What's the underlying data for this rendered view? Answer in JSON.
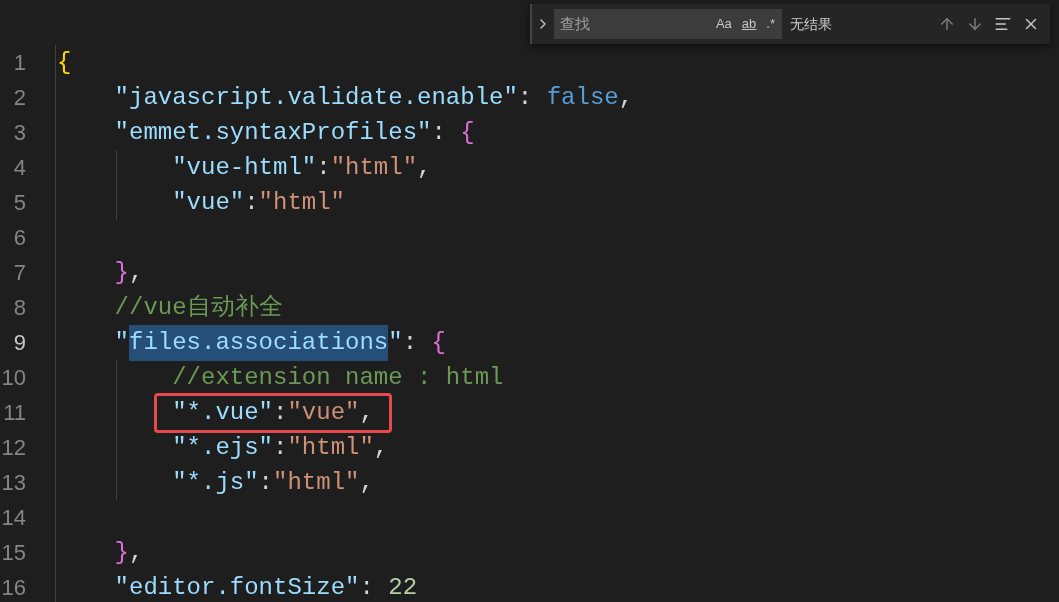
{
  "find_widget": {
    "expanded": false,
    "placeholder": "查找",
    "options": [
      {
        "label": "Aa",
        "selected": false
      },
      {
        "label": "ab",
        "selected": false
      },
      {
        "label": ".*",
        "selected": false
      }
    ],
    "result": "无结果"
  },
  "editor": {
    "lines": [
      {
        "number": "1",
        "current": false,
        "highlighted": false,
        "tokens": [
          {
            "kind": "brace-gold",
            "text": "{"
          }
        ]
      },
      {
        "number": "2",
        "current": false,
        "highlighted": false,
        "tokens": [
          {
            "kind": "key",
            "text": "\"javascript.validate.enable\""
          },
          {
            "kind": "plain",
            "text": ": "
          },
          {
            "kind": "keyword",
            "text": "false"
          },
          {
            "kind": "plain",
            "text": ","
          }
        ]
      },
      {
        "number": "3",
        "current": false,
        "highlighted": false,
        "tokens": [
          {
            "kind": "key",
            "text": "\"emmet.syntaxProfiles\""
          },
          {
            "kind": "plain",
            "text": ": "
          },
          {
            "kind": "brace-pink",
            "text": "{"
          }
        ]
      },
      {
        "number": "4",
        "current": false,
        "highlighted": false,
        "tokens": [
          {
            "kind": "key",
            "text": "\"vue-html\""
          },
          {
            "kind": "plain",
            "text": ":"
          },
          {
            "kind": "string",
            "text": "\"html\""
          },
          {
            "kind": "plain",
            "text": ","
          }
        ]
      },
      {
        "number": "5",
        "current": false,
        "highlighted": false,
        "tokens": [
          {
            "kind": "key",
            "text": "\"vue\""
          },
          {
            "kind": "plain",
            "text": ":"
          },
          {
            "kind": "string",
            "text": "\"html\""
          }
        ]
      },
      {
        "number": "6",
        "current": false,
        "highlighted": false
      },
      {
        "number": "7",
        "current": false,
        "highlighted": false,
        "tokens": [
          {
            "kind": "brace-pink",
            "text": "}"
          },
          {
            "kind": "plain",
            "text": ","
          }
        ]
      },
      {
        "number": "8",
        "current": false,
        "highlighted": false,
        "tokens": [
          {
            "kind": "comment",
            "text": "//vue自动补全"
          }
        ]
      },
      {
        "number": "9",
        "current": true,
        "highlighted": false,
        "tokens": [
          {
            "kind": "key",
            "text": "\""
          },
          {
            "kind": "key",
            "text": "files.associations",
            "selected": true
          },
          {
            "kind": "key",
            "text": "\""
          },
          {
            "kind": "plain",
            "text": ": "
          },
          {
            "kind": "brace-pink",
            "text": "{"
          }
        ]
      },
      {
        "number": "10",
        "current": false,
        "highlighted": false,
        "tokens": [
          {
            "kind": "comment",
            "text": "//extension name : html"
          }
        ]
      },
      {
        "number": "11",
        "current": false,
        "highlighted": true,
        "tokens": [
          {
            "kind": "key",
            "text": "\"*.vue\""
          },
          {
            "kind": "plain",
            "text": ":"
          },
          {
            "kind": "string",
            "text": "\"vue\""
          },
          {
            "kind": "plain",
            "text": ","
          }
        ]
      },
      {
        "number": "12",
        "current": false,
        "highlighted": false,
        "tokens": [
          {
            "kind": "key",
            "text": "\"*.ejs\""
          },
          {
            "kind": "plain",
            "text": ":"
          },
          {
            "kind": "string",
            "text": "\"html\""
          },
          {
            "kind": "plain",
            "text": ","
          }
        ]
      },
      {
        "number": "13",
        "current": false,
        "highlighted": false,
        "tokens": [
          {
            "kind": "key",
            "text": "\"*.js\""
          },
          {
            "kind": "plain",
            "text": ":"
          },
          {
            "kind": "string",
            "text": "\"html\""
          },
          {
            "kind": "plain",
            "text": ","
          }
        ]
      },
      {
        "number": "14",
        "current": false,
        "highlighted": false
      },
      {
        "number": "15",
        "current": false,
        "highlighted": false,
        "tokens": [
          {
            "kind": "brace-pink",
            "text": "}"
          },
          {
            "kind": "plain",
            "text": ","
          }
        ]
      },
      {
        "number": "16",
        "current": false,
        "highlighted": false,
        "tokens": [
          {
            "kind": "key",
            "text": "\"editor.fontSize\""
          },
          {
            "kind": "plain",
            "text": ": "
          },
          {
            "kind": "number",
            "text": "22"
          }
        ]
      }
    ]
  }
}
